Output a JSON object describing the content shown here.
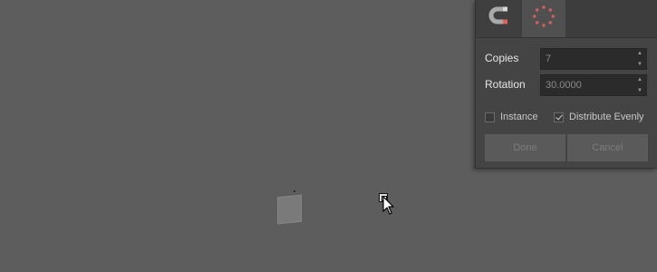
{
  "viewport": {
    "background": "#5d5d5d",
    "object_color": "#7a7a7a"
  },
  "panel": {
    "tabs": [
      {
        "icon": "magnet-icon",
        "active": false
      },
      {
        "icon": "radial-array-icon",
        "active": true
      }
    ],
    "copies": {
      "label": "Copies",
      "value": "7"
    },
    "rotation": {
      "label": "Rotation",
      "value": "30.0000"
    },
    "instance": {
      "label": "Instance",
      "checked": false
    },
    "distribute_evenly": {
      "label": "Distribute Evenly",
      "checked": true
    },
    "done_label": "Done",
    "cancel_label": "Cancel",
    "accent_color": "#e06060"
  }
}
